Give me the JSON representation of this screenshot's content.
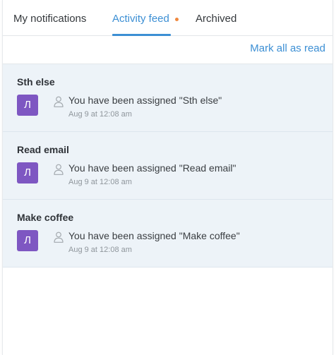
{
  "tabs": [
    {
      "label": "My notifications"
    },
    {
      "label": "Activity feed"
    },
    {
      "label": "Archived"
    }
  ],
  "actions": {
    "mark_all_label": "Mark all as read"
  },
  "colors": {
    "accent": "#3c8fd4",
    "unread_dot": "#f0883e",
    "avatar": "#7e57c2",
    "item_background": "#edf3f8"
  },
  "feed": {
    "items": [
      {
        "title": "Sth else",
        "avatar_initial": "Л",
        "icon": "user-icon",
        "text": "You have been assigned \"Sth else\"",
        "time": "Aug 9 at 12:08 am"
      },
      {
        "title": "Read email",
        "avatar_initial": "Л",
        "icon": "user-icon",
        "text": "You have been assigned \"Read email\"",
        "time": "Aug 9 at 12:08 am"
      },
      {
        "title": "Make coffee",
        "avatar_initial": "Л",
        "icon": "user-icon",
        "text": "You have been assigned \"Make coffee\"",
        "time": "Aug 9 at 12:08 am"
      }
    ]
  }
}
